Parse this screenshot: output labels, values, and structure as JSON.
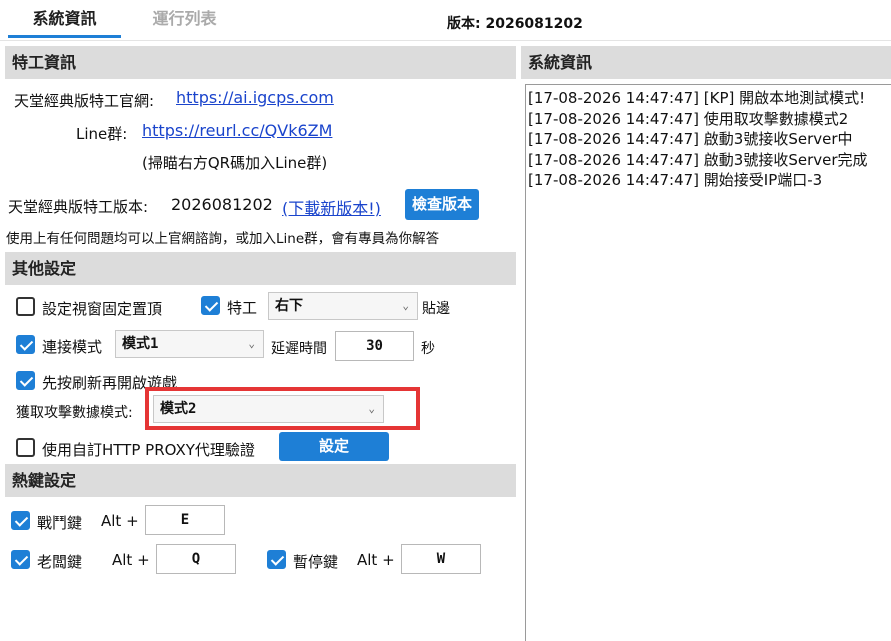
{
  "tabs": [
    {
      "label": "系統資訊",
      "active": true
    },
    {
      "label": "運行列表",
      "active": false
    }
  ],
  "version_header": "版本: 2026081202",
  "agent_info": {
    "section_title": "特工資訊",
    "site_label": "天堂經典版特工官網:",
    "site_url": "https://ai.igcps.com",
    "line_label": "Line群:",
    "line_url": "https://reurl.cc/QVk6ZM",
    "qr_note": "(掃瞄右方QR碼加入Line群)",
    "version_label": "天堂經典版特工版本:",
    "version_value": "2026081202",
    "download_link": "(下載新版本!)",
    "check_button": "檢查版本",
    "help_text": "使用上有任何問題均可以上官網諮詢，或加入Line群，會有專員為你解答"
  },
  "other_settings": {
    "section_title": "其他設定",
    "pin_window": {
      "label": "設定視窗固定置頂",
      "checked": false
    },
    "agent": {
      "label": "特工",
      "checked": true,
      "position_value": "右下",
      "suffix": "貼邊"
    },
    "connect_mode": {
      "label": "連接模式",
      "checked": true,
      "mode_value": "模式1",
      "delay_label": "延遲時間",
      "delay_value": "30",
      "delay_unit": "秒"
    },
    "refresh_first": {
      "label": "先按刷新再開啟遊戲",
      "checked": true
    },
    "attack_data_mode": {
      "label": "獲取攻擊數據模式:",
      "value": "模式2"
    },
    "http_proxy": {
      "label": "使用自訂HTTP PROXY代理驗證",
      "checked": false,
      "button": "設定"
    }
  },
  "hotkeys": {
    "section_title": "熱鍵設定",
    "battle": {
      "label": "戰鬥鍵",
      "checked": true,
      "modifier": "Alt +",
      "key": "E"
    },
    "boss": {
      "label": "老闆鍵",
      "checked": true,
      "modifier": "Alt +",
      "key": "Q"
    },
    "pause": {
      "label": "暫停鍵",
      "checked": true,
      "modifier": "Alt +",
      "key": "W"
    }
  },
  "system_log": {
    "section_title": "系統資訊",
    "lines": [
      "[17-08-2026 14:47:47] [KP] 開啟本地測試模式!",
      "[17-08-2026 14:47:47] 使用取攻擊數據模式2",
      "[17-08-2026 14:47:47] 啟動3號接收Server中",
      "[17-08-2026 14:47:47] 啟動3號接收Server完成",
      "[17-08-2026 14:47:47] 開始接受IP端口-3"
    ]
  },
  "colors": {
    "accent": "#1e7fd6",
    "section_bg": "#dcdcdc",
    "highlight": "#e53535",
    "link": "#1a44cc"
  }
}
